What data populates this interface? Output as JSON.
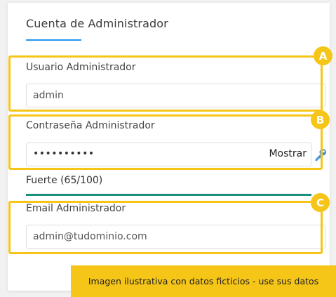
{
  "card": {
    "title": "Cuenta de Administrador"
  },
  "fields": {
    "username": {
      "label": "Usuario Administrador",
      "value": "admin"
    },
    "password": {
      "label": "Contraseña Administrador",
      "value": "••••••••••",
      "show_label": "Mostrar",
      "icon": "key-icon",
      "strength_text": "Fuerte (65/100)",
      "strength_score": 65,
      "strength_color": "#1a8f7c"
    },
    "email": {
      "label": "Email Administrador",
      "value": "admin@tudominio.com"
    }
  },
  "annotations": {
    "a": "A",
    "b": "B",
    "c": "C"
  },
  "colors": {
    "accent": "#2196f3",
    "highlight": "#f5c518"
  },
  "disclaimer": "Imagen ilustrativa con datos ficticios - use sus datos"
}
